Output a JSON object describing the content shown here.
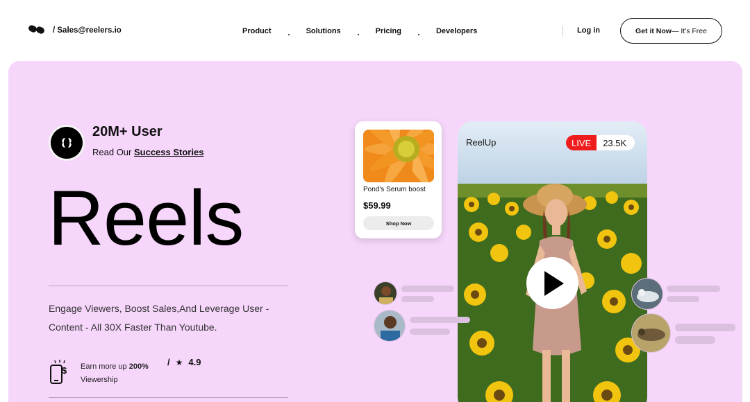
{
  "nav": {
    "email": "/ Sales@reelers.io",
    "menu": [
      "Product",
      "Solutions",
      "Pricing",
      "Developers"
    ],
    "login": "Log in",
    "cta_strong": "Get it Now",
    "cta_rest": " — It's Free"
  },
  "hero": {
    "users": "20M+ User",
    "stories_prefix": "Read Our ",
    "stories_link": "Success Stories",
    "headline": "Reels",
    "description": "Engage Viewers, Boost Sales,And Leverage User - Content - All 30X Faster Than Youtube.",
    "earn_prefix": "Earn more up ",
    "earn_value": "200%",
    "earn_suffix": "Viewership",
    "rating_sep": "/",
    "rating": "4.9"
  },
  "product": {
    "name": "Pond's Serum boost",
    "price": "$59.99",
    "button": "Shop Now"
  },
  "phone": {
    "app": "ReelUp",
    "live": "LIVE",
    "viewers": "23.5K"
  },
  "colors": {
    "hero_bg": "#f6d6fb",
    "live_red": "#ee1c1c",
    "skeleton": "#dcc0e0"
  },
  "icons": [
    "logo-icon",
    "reels-logo-icon",
    "phone-dollar-icon",
    "star-icon",
    "play-icon"
  ]
}
